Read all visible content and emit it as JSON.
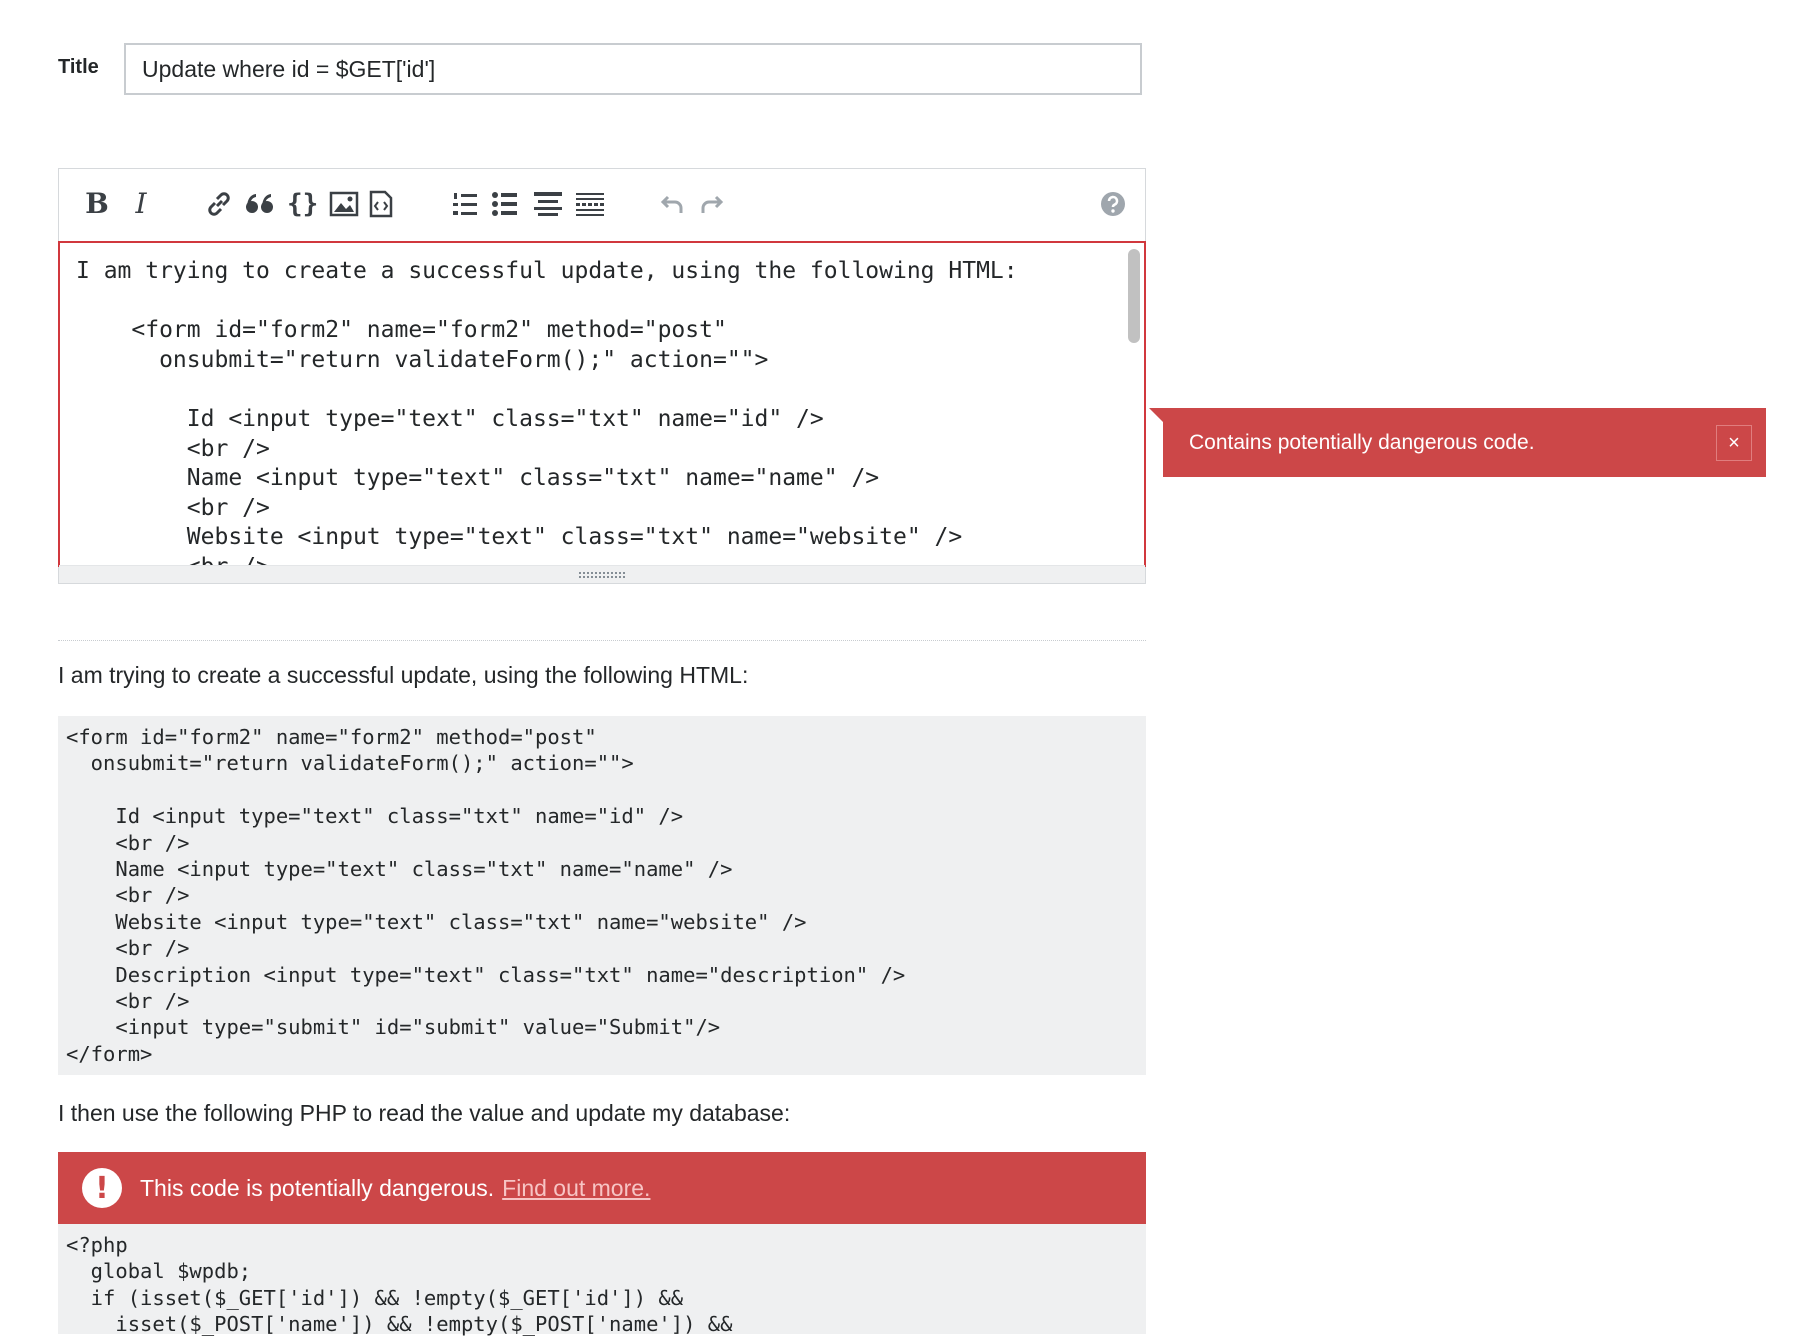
{
  "title_field": {
    "label": "Title",
    "value": "Update where id = $GET['id']"
  },
  "toolbar": {
    "buttons": [
      {
        "name": "bold-icon",
        "glyph": "B"
      },
      {
        "name": "italic-icon",
        "glyph": "I"
      },
      {
        "name": "link-icon"
      },
      {
        "name": "blockquote-icon"
      },
      {
        "name": "code-icon",
        "glyph": "{}"
      },
      {
        "name": "image-icon"
      },
      {
        "name": "snippet-icon"
      },
      {
        "name": "ordered-list-icon"
      },
      {
        "name": "bulleted-list-icon"
      },
      {
        "name": "heading-icon"
      },
      {
        "name": "horizontal-rule-icon"
      },
      {
        "name": "undo-icon"
      },
      {
        "name": "redo-icon"
      },
      {
        "name": "help-icon"
      }
    ]
  },
  "editor": {
    "text": "I am trying to create a successful update, using the following HTML:\n\n    <form id=\"form2\" name=\"form2\" method=\"post\"\n      onsubmit=\"return validateForm();\" action=\"\">\n\n        Id <input type=\"text\" class=\"txt\" name=\"id\" />\n        <br />\n        Name <input type=\"text\" class=\"txt\" name=\"name\" />\n        <br />\n        Website <input type=\"text\" class=\"txt\" name=\"website\" />\n        <br />"
  },
  "popup": {
    "message": "Contains potentially dangerous code.",
    "close_glyph": "×"
  },
  "preview": {
    "paragraph_1": "I am trying to create a successful update, using the following HTML:",
    "html_code": "<form id=\"form2\" name=\"form2\" method=\"post\"\n  onsubmit=\"return validateForm();\" action=\"\">\n\n    Id <input type=\"text\" class=\"txt\" name=\"id\" />\n    <br />\n    Name <input type=\"text\" class=\"txt\" name=\"name\" />\n    <br />\n    Website <input type=\"text\" class=\"txt\" name=\"website\" />\n    <br />\n    Description <input type=\"text\" class=\"txt\" name=\"description\" />\n    <br />\n    <input type=\"submit\" id=\"submit\" value=\"Submit\"/>\n</form>",
    "paragraph_2": "I then use the following PHP to read the value and update my database:",
    "warning": {
      "icon_glyph": "!",
      "text": "This code is potentially dangerous.",
      "link": "Find out more."
    },
    "php_code": "<?php\n  global $wpdb;\n  if (isset($_GET['id']) && !empty($_GET['id']) &&\n    isset($_POST['name']) && !empty($_POST['name']) &&"
  },
  "colors": {
    "danger": "#cc4748",
    "border_error": "#d1383d",
    "code_bg": "#eff0f1"
  }
}
